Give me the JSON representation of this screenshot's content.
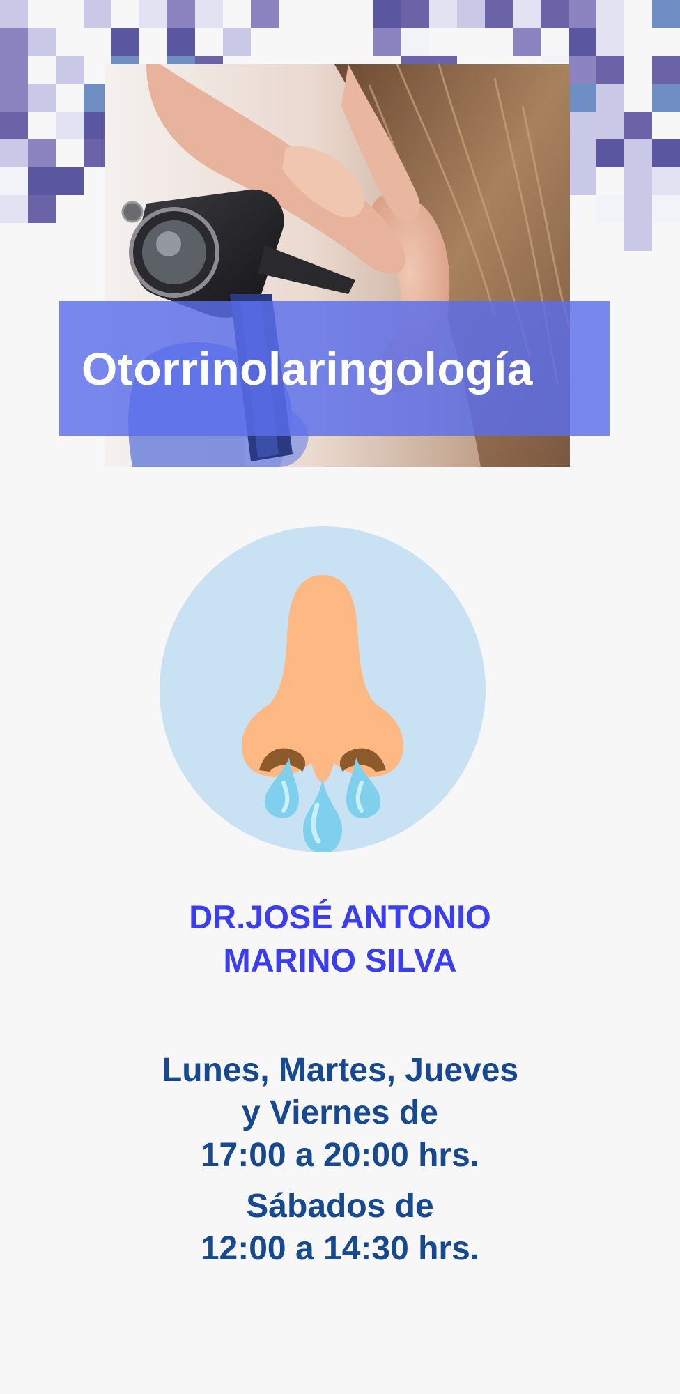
{
  "header": {
    "title": "Otorrinolaringología"
  },
  "doctor": {
    "name_line1": "DR.JOSÉ ANTONIO",
    "name_line2": "MARINO SILVA"
  },
  "schedule": {
    "weekday_line1": "Lunes, Martes, Jueves",
    "weekday_line2": "y Viernes de",
    "weekday_hours": "17:00 a 20:00 hrs.",
    "saturday_line1": "Sábados de",
    "saturday_hours": "12:00 a 14:30 hrs."
  },
  "colors": {
    "band": "#5a6eeb",
    "doctor_name": "#3a3df0",
    "schedule_text": "#16498f",
    "icon_circle": "#c9e2f3",
    "nose": "#fdb883",
    "drops": "#7fd0ec"
  },
  "icons": {
    "header_photo": "otoscope-ear-exam-photo",
    "main_icon": "nose-drops-icon"
  }
}
